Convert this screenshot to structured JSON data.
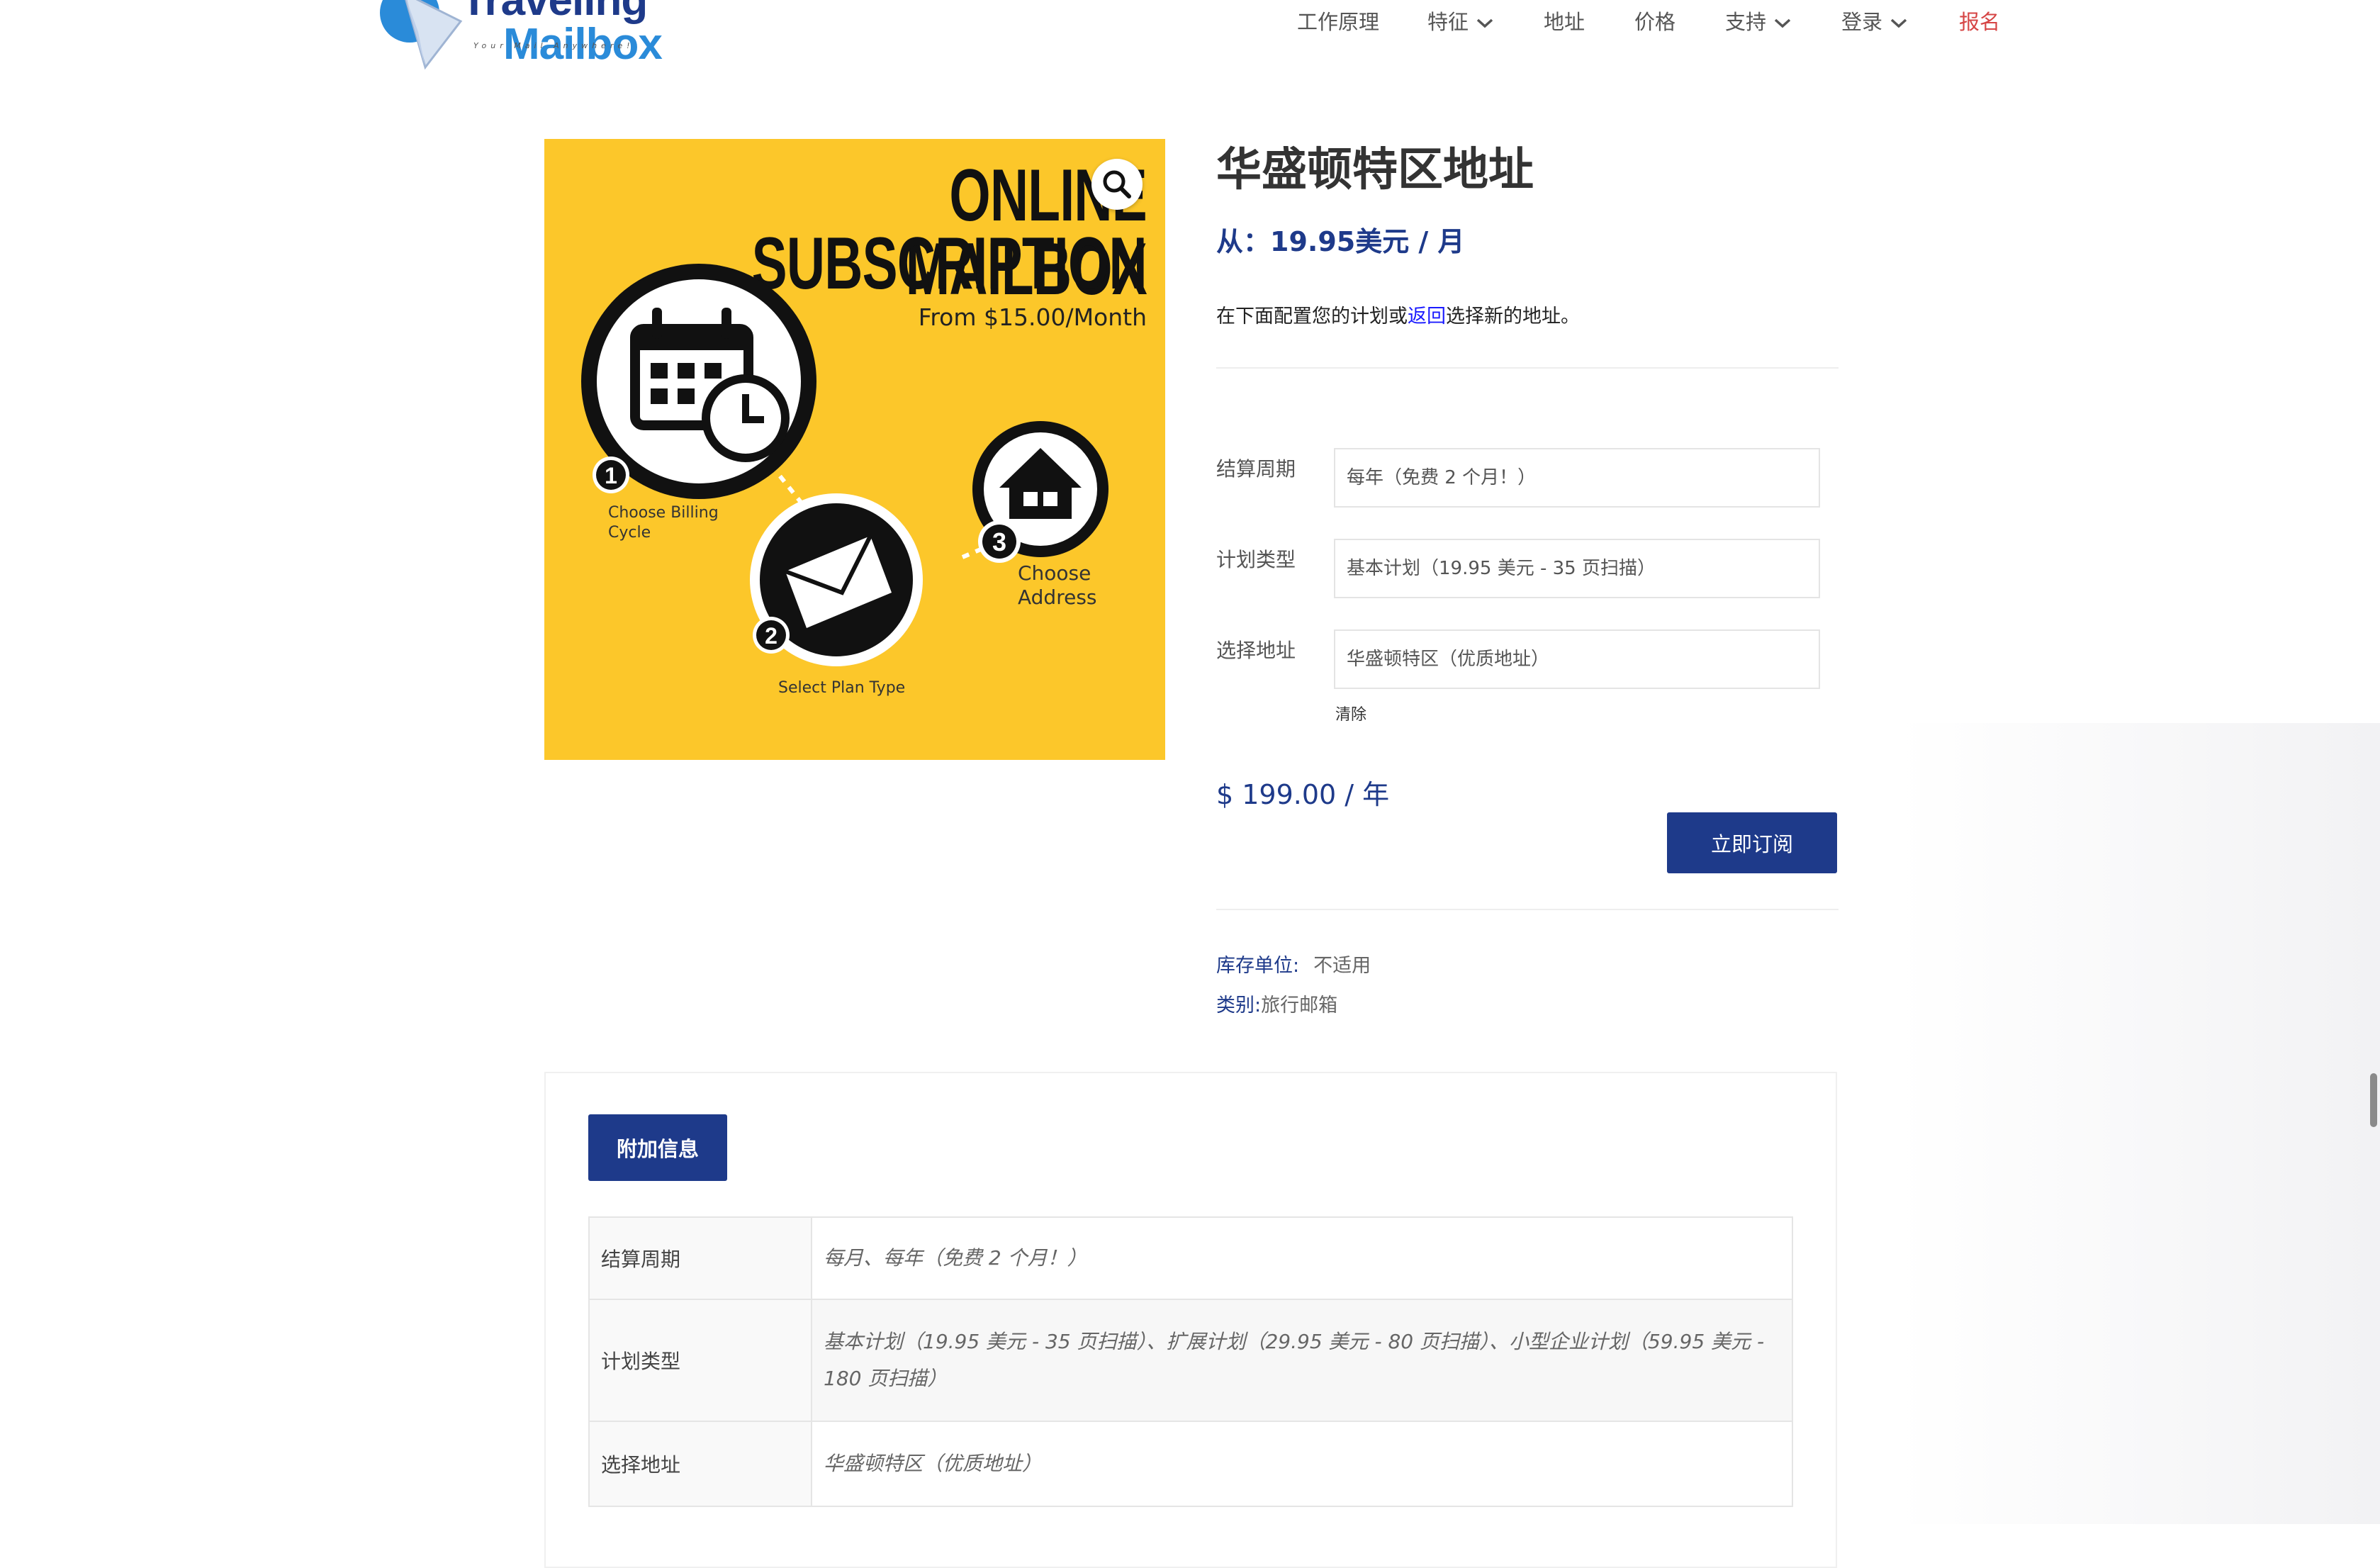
{
  "brand": {
    "name_line1": "Traveling",
    "name_line2": "Mailbox",
    "tagline": "Your Mail Anywhere!"
  },
  "nav": {
    "items": [
      {
        "label": "工作原理"
      },
      {
        "label": "特征"
      },
      {
        "label": "地址"
      },
      {
        "label": "价格"
      },
      {
        "label": "支持"
      },
      {
        "label": "登录"
      },
      {
        "label": "报名"
      }
    ]
  },
  "product_image": {
    "title_line1": "ONLINE MAILBOX",
    "title_line2": "SUBSCRIPTION",
    "from": "From $15.00/Month",
    "step1": "Choose Billing Cycle",
    "step2": "Select Plan Type",
    "step3": "Choose Address"
  },
  "product": {
    "title": "华盛顿特区地址",
    "price_from": "从：19.95美元 / 月",
    "desc_before": "在下面配置您的计划或",
    "desc_link": "返回",
    "desc_after": "选择新的地址。"
  },
  "options": {
    "billing_label": "结算周期",
    "billing_value": "每年（免费 2 个月！）",
    "plan_label": "计划类型",
    "plan_value": "基本计划（19.95 美元 - 35 页扫描）",
    "address_label": "选择地址",
    "address_value": "华盛顿特区（优质地址）",
    "clear": "清除"
  },
  "total": "$ 199.00 / 年",
  "subscribe_label": "立即订阅",
  "meta": {
    "sku_label": "库存单位:",
    "sku_value": "不适用",
    "category_label": "类别:",
    "category_value": "旅行邮箱"
  },
  "additional_info": {
    "tab_label": "附加信息",
    "rows": [
      {
        "label": "结算周期",
        "value": "每月、每年（免费 2 个月！）"
      },
      {
        "label": "计划类型",
        "value": "基本计划（19.95 美元 - 35 页扫描）、扩展计划（29.95 美元 - 80 页扫描）、小型企业计划（59.95 美元 - 180 页扫描）"
      },
      {
        "label": "选择地址",
        "value": "华盛顿特区（优质地址）"
      }
    ]
  },
  "colors": {
    "brand_blue": "#1e3a8a",
    "signup_red": "#d64545",
    "image_yellow": "#fcc72a"
  }
}
